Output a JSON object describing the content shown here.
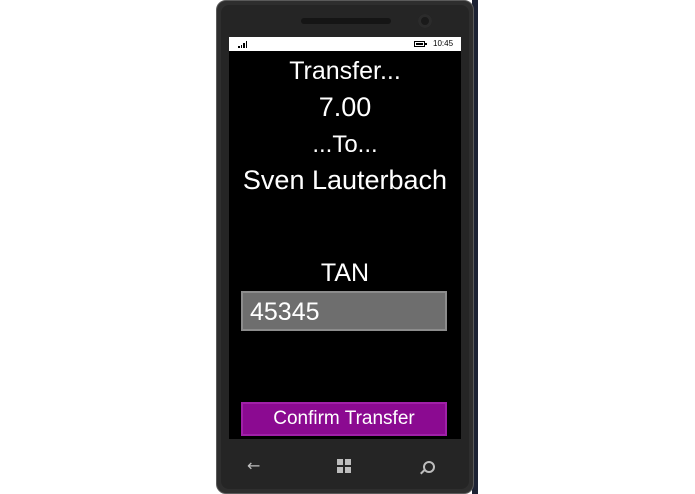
{
  "status_bar": {
    "time": "10:45"
  },
  "screen": {
    "transfer_label": "Transfer...",
    "amount": "7.00",
    "to_label": "...To...",
    "recipient": "Sven Lauterbach",
    "tan_label": "TAN",
    "tan_value": "45345",
    "confirm_button": "Confirm Transfer"
  },
  "colors": {
    "accent": "#8b0a91",
    "screen_background": "#000000",
    "input_background": "#6e6e6e"
  },
  "icons": [
    "signal-icon",
    "battery-icon",
    "back-icon",
    "windows-icon",
    "search-icon"
  ]
}
